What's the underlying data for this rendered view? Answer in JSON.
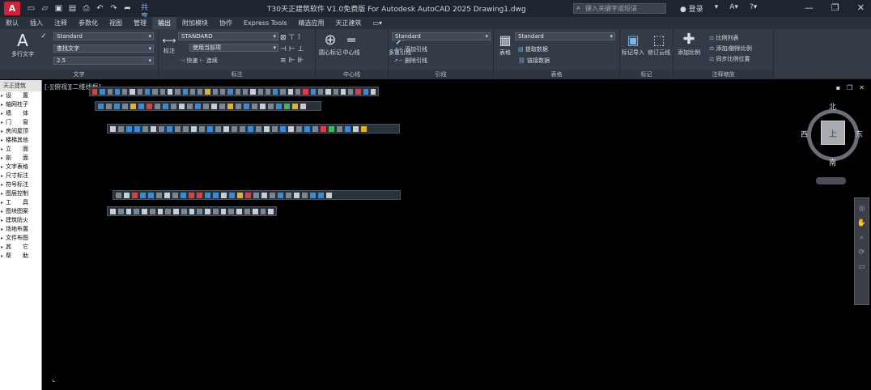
{
  "titlebar": {
    "logo": "A",
    "share_label": "共享",
    "title": "T30天正建筑软件 V1.0免费版 For Autodesk AutoCAD 2025   Drawing1.dwg",
    "search_placeholder": "键入关键字或短语",
    "user_label": "登录"
  },
  "tabs": [
    "默认",
    "插入",
    "注释",
    "参数化",
    "视图",
    "管理",
    "输出",
    "附加模块",
    "协作",
    "Express Tools",
    "精选应用",
    "天正建筑"
  ],
  "active_tab": "注释",
  "ribbon": {
    "text_panel": {
      "multiline_text": "多行文字",
      "check_spelling": "检查",
      "style_value": "Standard",
      "find_placeholder": "查找文字",
      "height_value": "2.5",
      "title": "文字"
    },
    "dim_panel": {
      "dimension": "标注",
      "style_value": "STANDARD",
      "layer_value": "使用当前项",
      "continue": "快速",
      "baseline": "连续",
      "title": "标注"
    },
    "center_panel": {
      "center_mark": "圆心标记",
      "centerline": "中心线",
      "title": "中心线"
    },
    "leader_panel": {
      "multileader": "多重引线",
      "style_value": "Standard",
      "add_leader": "添加引线",
      "remove_leader": "删除引线",
      "title": "引线"
    },
    "table_panel": {
      "table": "表格",
      "style_value": "Standard",
      "extract_data": "提取数据",
      "link_data": "链接数据",
      "title": "表格"
    },
    "markup_panel": {
      "markup_import": "标记导入",
      "revcloud": "修订云线",
      "title": "标记"
    },
    "scale_panel": {
      "add_scale": "添加比例",
      "scale_list": "比例列表",
      "add_delete_scale": "添加/删除比例",
      "sync_scale": "同步比例位置",
      "title": "注释缩放"
    }
  },
  "viewport": {
    "label": "[-][俯视][二维线框]"
  },
  "sidebar": {
    "header": "天正建筑",
    "items": [
      "设　　置",
      "轴网柱子",
      "墙　　体",
      "门　　窗",
      "房间屋顶",
      "楼梯其他",
      "立　　面",
      "剖　　面",
      "文字表格",
      "尺寸标注",
      "符号标注",
      "图层控制",
      "工　　具",
      "图块图案",
      "建筑防火",
      "场地布置",
      "文件布图",
      "其　　它",
      "帮　　助"
    ]
  },
  "viewcube": {
    "north": "北",
    "south": "南",
    "east": "东",
    "west": "西",
    "face": "上"
  }
}
